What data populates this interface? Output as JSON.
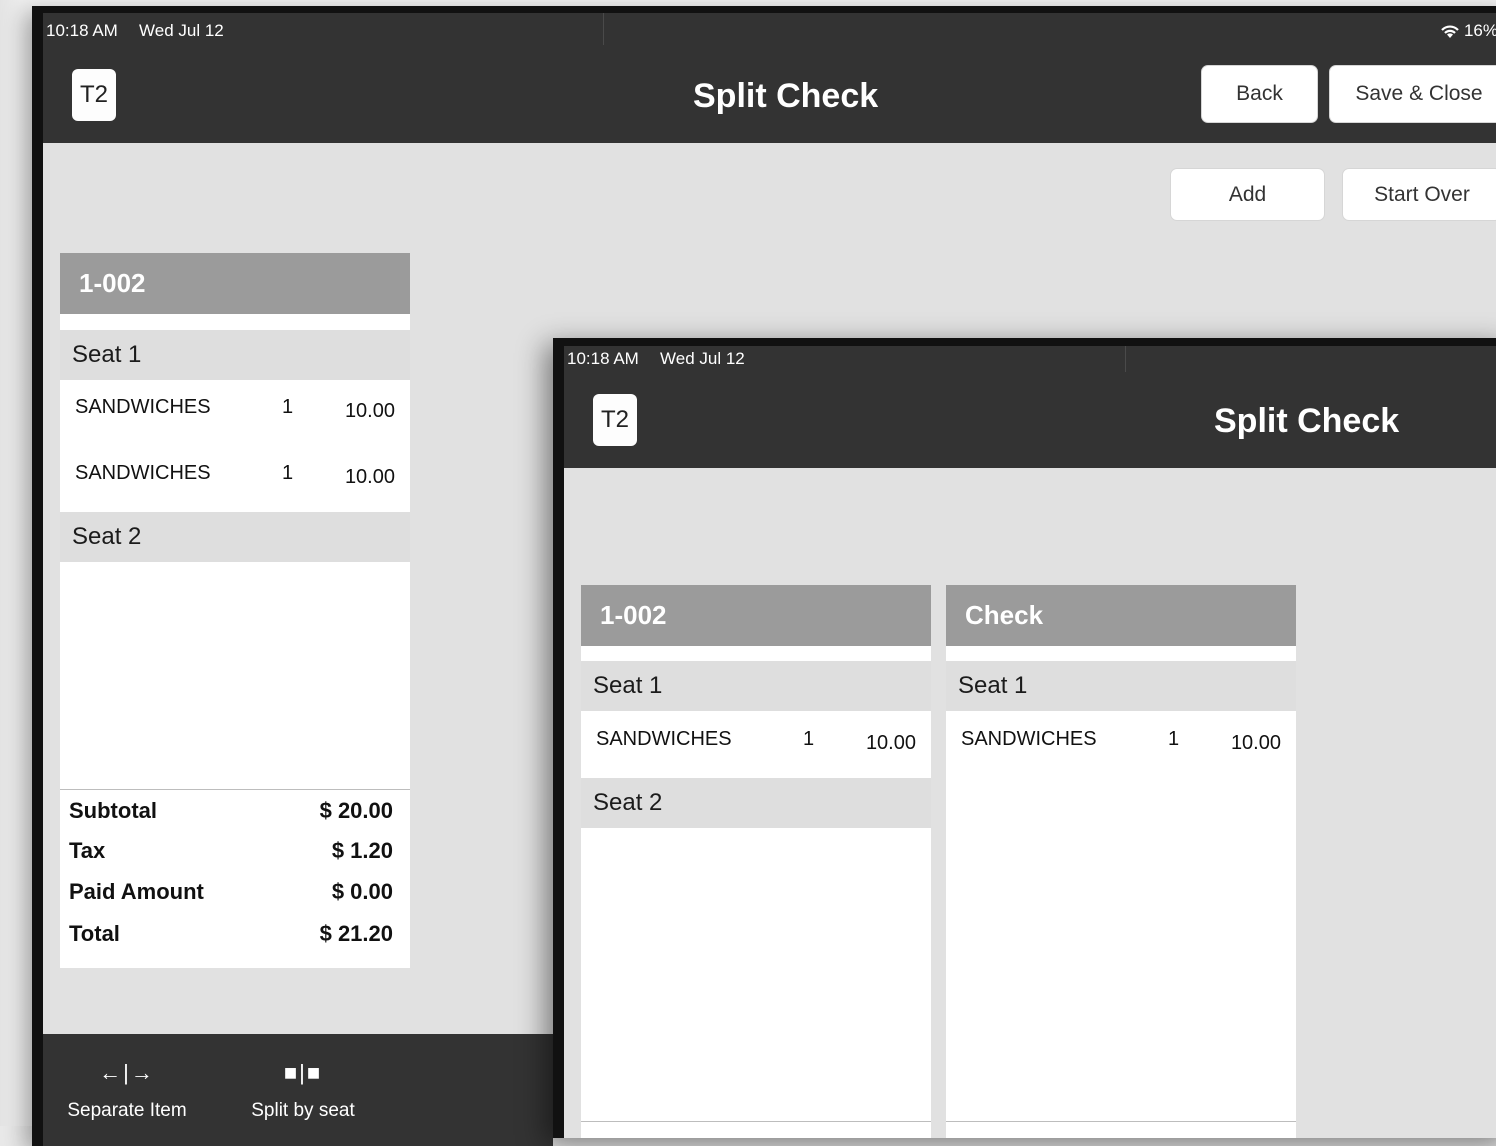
{
  "back": {
    "status": {
      "time": "10:18 AM",
      "date": "Wed Jul 12",
      "battery": "16%"
    },
    "header": {
      "badge": "T2",
      "title": "Split Check",
      "back_label": "Back",
      "save_label": "Save & Close"
    },
    "actions": {
      "add_label": "Add",
      "start_over_label": "Start Over"
    },
    "check": {
      "title": "1-002",
      "seat1": "Seat 1",
      "items": [
        {
          "name": "SANDWICHES",
          "qty": "1",
          "amount": "10.00"
        },
        {
          "name": "SANDWICHES",
          "qty": "1",
          "amount": "10.00"
        }
      ],
      "seat2": "Seat 2",
      "totals": {
        "subtotal_label": "Subtotal",
        "subtotal": "$ 20.00",
        "tax_label": "Tax",
        "tax": "$ 1.20",
        "paid_label": "Paid Amount",
        "paid": "$ 0.00",
        "total_label": "Total",
        "total": "$ 21.20"
      }
    },
    "toolbar": {
      "separate_icon": "←|→",
      "separate_label": "Separate Item",
      "split_icon": "■|■",
      "split_label": "Split by seat"
    }
  },
  "front": {
    "status": {
      "time": "10:18 AM",
      "date": "Wed Jul 12"
    },
    "header": {
      "badge": "T2",
      "title": "Split Check"
    },
    "check_original": {
      "title": "1-002",
      "seat1": "Seat 1",
      "items": [
        {
          "name": "SANDWICHES",
          "qty": "1",
          "amount": "10.00"
        }
      ],
      "seat2": "Seat 2"
    },
    "check_new": {
      "title": "Check",
      "seat1": "Seat 1",
      "items": [
        {
          "name": "SANDWICHES",
          "qty": "1",
          "amount": "10.00"
        }
      ]
    }
  }
}
